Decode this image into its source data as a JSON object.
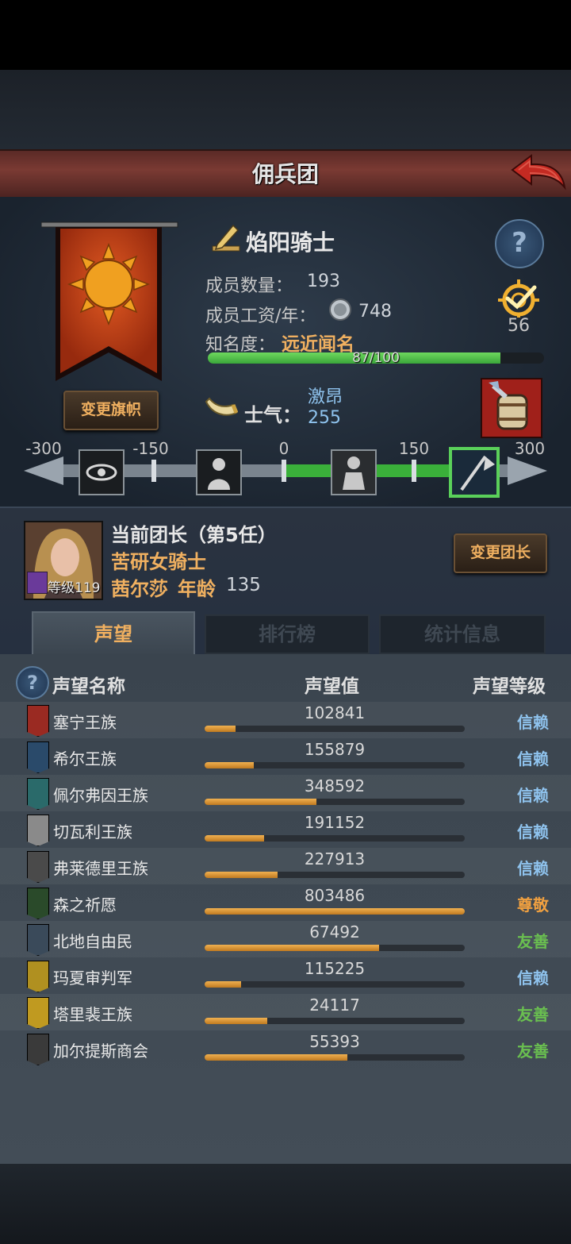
{
  "header": {
    "title": "佣兵团"
  },
  "team": {
    "name": "焰阳骑士",
    "member_count_label": "成员数量：",
    "member_count": "193",
    "salary_label": "成员工资/年：",
    "salary": "748",
    "fame_label": "知名度：",
    "fame_title": "远近闻名",
    "fame_text": "87/100",
    "fame_fraction": 0.87,
    "change_banner_label": "变更旗帜",
    "target_value": "56"
  },
  "morale": {
    "label": "士气：",
    "state": "激昂",
    "value": "255"
  },
  "morale_scale": {
    "ticks": [
      "-300",
      "-150",
      "0",
      "150",
      "300"
    ],
    "current_value": 255
  },
  "leader": {
    "title": "当前团长（第5任）",
    "class": "苦研女骑士",
    "name": "茜尔莎",
    "age_label": "年龄",
    "age": "135",
    "level": "等级119",
    "change_label": "变更团长"
  },
  "tabs": [
    "声望",
    "排行榜",
    "统计信息"
  ],
  "reputation": {
    "headers": {
      "name": "声望名称",
      "value": "声望值",
      "level": "声望等级"
    },
    "rows": [
      {
        "name": "塞宁王族",
        "value": "102841",
        "fill": 0.12,
        "level": "信赖",
        "level_color": "#8fc3ee",
        "icon_color": "#9a2a22"
      },
      {
        "name": "希尔王族",
        "value": "155879",
        "fill": 0.19,
        "level": "信赖",
        "level_color": "#8fc3ee",
        "icon_color": "#2a4a6a"
      },
      {
        "name": "佩尔弗因王族",
        "value": "348592",
        "fill": 0.43,
        "level": "信赖",
        "level_color": "#8fc3ee",
        "icon_color": "#2a6a6a"
      },
      {
        "name": "切瓦利王族",
        "value": "191152",
        "fill": 0.23,
        "level": "信赖",
        "level_color": "#8fc3ee",
        "icon_color": "#8a8a8a"
      },
      {
        "name": "弗莱德里王族",
        "value": "227913",
        "fill": 0.28,
        "level": "信赖",
        "level_color": "#8fc3ee",
        "icon_color": "#4a4a4a"
      },
      {
        "name": "森之祈愿",
        "value": "803486",
        "fill": 1.0,
        "level": "尊敬",
        "level_color": "#f0a040",
        "icon_color": "#2a4a2a"
      },
      {
        "name": "北地自由民",
        "value": "67492",
        "fill": 0.67,
        "level": "友善",
        "level_color": "#6ac050",
        "icon_color": "#3a4a5a"
      },
      {
        "name": "玛夏审判军",
        "value": "115225",
        "fill": 0.14,
        "level": "信赖",
        "level_color": "#8fc3ee",
        "icon_color": "#b09020"
      },
      {
        "name": "塔里裴王族",
        "value": "24117",
        "fill": 0.24,
        "level": "友善",
        "level_color": "#6ac050",
        "icon_color": "#c09a20"
      },
      {
        "name": "加尔提斯商会",
        "value": "55393",
        "fill": 0.55,
        "level": "友善",
        "level_color": "#6ac050",
        "icon_color": "#3a3a3a"
      }
    ]
  },
  "icons": {
    "back": "back-arrow-icon",
    "help": "question-mark-icon",
    "edit": "edit-pencil-icon",
    "silver": "silver-coin-icon",
    "target": "target-check-icon",
    "horn": "horn-icon",
    "barrel": "barrel-icon",
    "banner": "sun-banner-icon"
  }
}
